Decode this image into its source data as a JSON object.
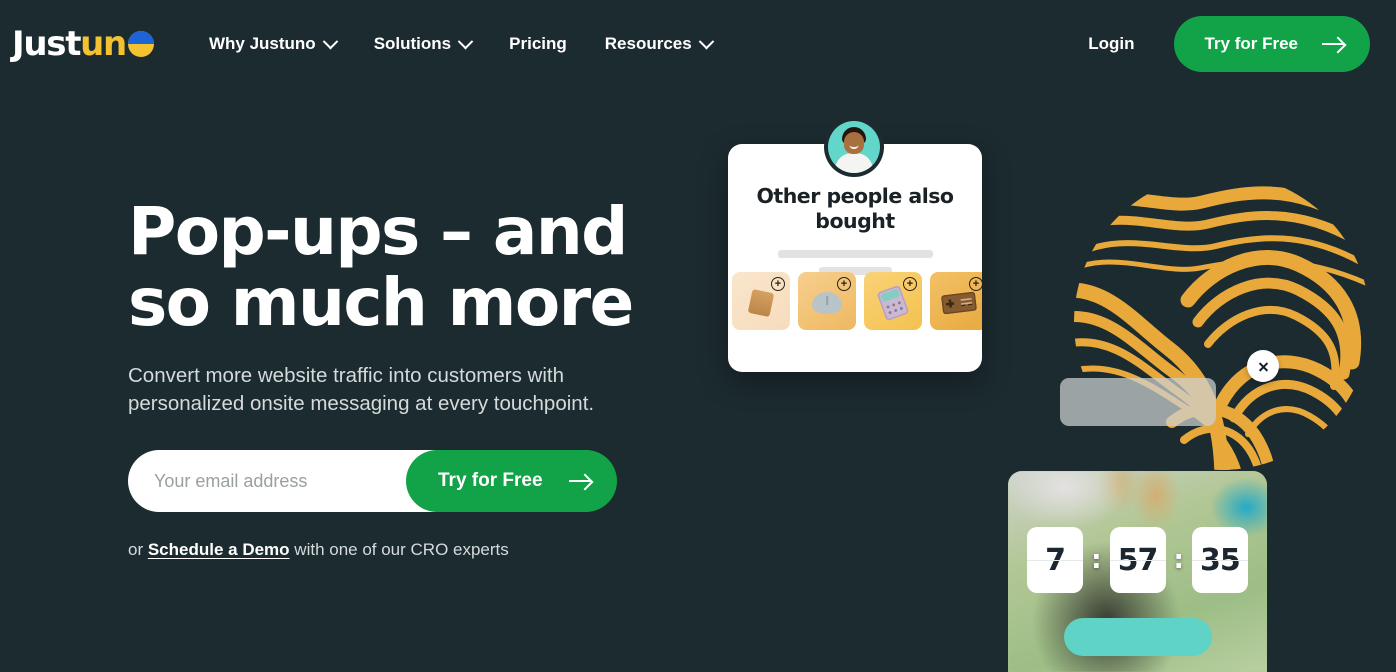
{
  "brand": {
    "logo_just": "Just",
    "logo_un": "un",
    "logo_o_name": "o",
    "accent_green": "#12a348",
    "accent_yellow": "#f2c230",
    "accent_blue": "#1d64d8",
    "accent_teal": "#5ed3c6",
    "background": "#1c2b30"
  },
  "header": {
    "nav": [
      {
        "label": "Why Justuno",
        "has_dropdown": true
      },
      {
        "label": "Solutions",
        "has_dropdown": true
      },
      {
        "label": "Pricing",
        "has_dropdown": false
      },
      {
        "label": "Resources",
        "has_dropdown": true
      }
    ],
    "login_label": "Login",
    "cta_label": "Try for Free"
  },
  "hero": {
    "title": "Pop-ups – and\nso much more",
    "subtitle": "Convert more website traffic into customers with\npersonalized onsite messaging at every touchpoint.",
    "email_placeholder": "Your email address",
    "email_value": "",
    "cta_label": "Try for Free",
    "demo_prefix": "or ",
    "demo_link": "Schedule a Demo",
    "demo_suffix": " with one of our CRO experts"
  },
  "popup_card": {
    "title": "Other people also bought",
    "tiles": [
      {
        "name": "product-tile-fan",
        "plus": "+"
      },
      {
        "name": "product-tile-mouse",
        "plus": "+"
      },
      {
        "name": "product-tile-calculator",
        "plus": "+"
      },
      {
        "name": "product-tile-gamepad",
        "plus": "+"
      }
    ]
  },
  "timer_card": {
    "hours": "7",
    "minutes": "57",
    "seconds": "35",
    "separator": ":"
  },
  "overlay": {
    "close_label": "×"
  }
}
